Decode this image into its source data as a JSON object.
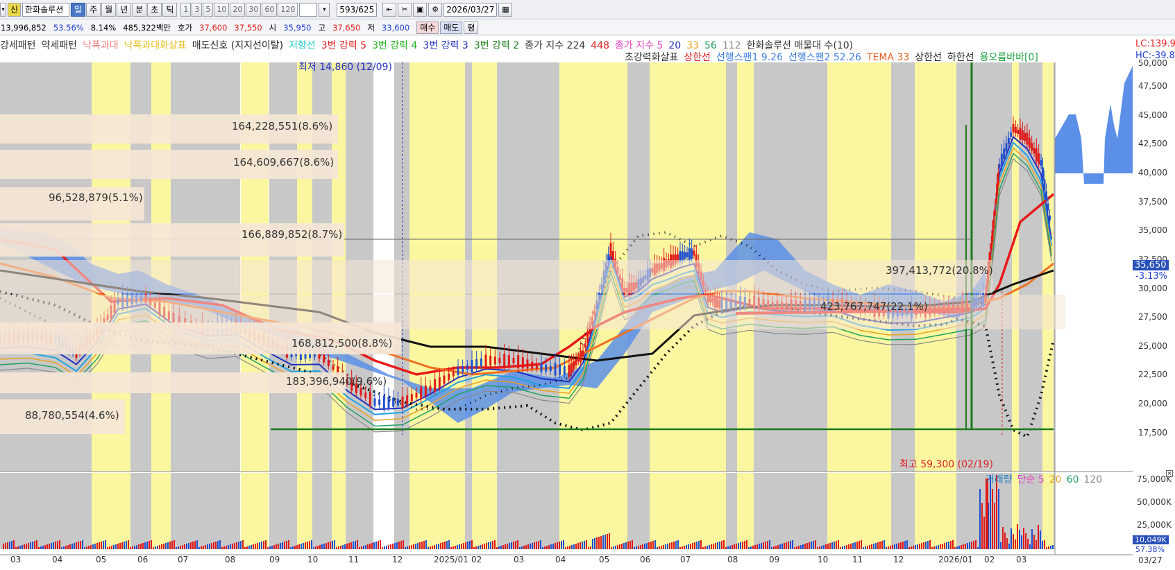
{
  "toolbar": {
    "stock_badge": "신",
    "stock_name": "한화솔루션",
    "periods": [
      "일",
      "주",
      "월",
      "년",
      "분",
      "초",
      "틱"
    ],
    "intervals": [
      "1",
      "3",
      "5",
      "10",
      "20",
      "30",
      "60",
      "120"
    ],
    "count": "593/625",
    "date": "2026/03/27"
  },
  "quote": {
    "volume": "13,996,852",
    "pct1": "53.56%",
    "pct2": "8.14%",
    "amount": "485,322백만",
    "hoga_label": "호가",
    "ask": "37,600",
    "bid": "37,550",
    "open_label": "시",
    "open": "35,950",
    "high_label": "고",
    "high": "37,650",
    "low_label": "저",
    "low": "33,600",
    "buy_btn": "매수",
    "sell_btn": "매도",
    "eval_btn": "평"
  },
  "legend": {
    "row1": [
      {
        "text": "강세패턴",
        "color": "#333333"
      },
      {
        "text": "약세패턴",
        "color": "#333333"
      },
      {
        "text": "낙폭과대",
        "color": "#f08080"
      },
      {
        "text": "낙폭과대화살표",
        "color": "#e8c020"
      },
      {
        "text": "매도신호 (지지선이탈)",
        "color": "#222222"
      },
      {
        "text": "저항선",
        "color": "#20c8c8"
      },
      {
        "text": "3번 강력 5",
        "color": "#e02020"
      },
      {
        "text": "3번 강력 4",
        "color": "#20b020"
      },
      {
        "text": "3번 강력 3",
        "color": "#2030c0"
      },
      {
        "text": "3번 강력 2",
        "color": "#208020"
      },
      {
        "text": "종가 지수 224",
        "color": "#333333"
      },
      {
        "text": "448",
        "color": "#e02020"
      },
      {
        "text": "종가 지수 5",
        "color": "#e040c0"
      },
      {
        "text": "20",
        "color": "#2030c0"
      },
      {
        "text": "33",
        "color": "#e8a020"
      },
      {
        "text": "56",
        "color": "#20a060"
      },
      {
        "text": "112",
        "color": "#888888"
      },
      {
        "text": "한화솔루션 매물대 수(10)",
        "color": "#333333"
      }
    ],
    "row2": [
      {
        "text": "초강력화살표",
        "color": "#333333"
      },
      {
        "text": "상한선",
        "color": "#e02020"
      },
      {
        "text": "선행스팬1 9.26",
        "color": "#4080e0"
      },
      {
        "text": "선행스팬2 52.26",
        "color": "#4080e0"
      },
      {
        "text": "TEMA 33",
        "color": "#e86020"
      },
      {
        "text": "상한선",
        "color": "#222222"
      },
      {
        "text": "하한선",
        "color": "#222222"
      },
      {
        "text": "용오름바바[0]",
        "color": "#20a040"
      }
    ],
    "lc": "LC:139.9",
    "hc": "HC:-39.8"
  },
  "volume_profile": [
    {
      "label": "164,228,551(8.6%)"
    },
    {
      "label": "164,609,667(8.6%)"
    },
    {
      "label": "96,528,879(5.1%)"
    },
    {
      "label": "166,889,852(8.7%)"
    },
    {
      "label": "397,413,772(20.8%)"
    },
    {
      "label": "423,767,747(22.1%)"
    },
    {
      "label": "183,396,940(9.6%)"
    },
    {
      "label": "88,780,554(4.6%)"
    },
    {
      "label": "168,812,500(8.8%)"
    }
  ],
  "annotations": {
    "low": "최저 14,860 (12/09)",
    "high": "최고 59,300 (02/19)"
  },
  "price_axis": [
    "50,000",
    "47,500",
    "45,000",
    "42,500",
    "40,000",
    "37,500",
    "35,000",
    "32,500",
    "30,000",
    "27,500",
    "25,000",
    "22,500",
    "20,000",
    "17,500"
  ],
  "current_price": "35,650",
  "current_change": "-3.13%",
  "volume_legend": [
    {
      "text": "거래량",
      "color": "#2080c0"
    },
    {
      "text": "단순 5",
      "color": "#e040c0"
    },
    {
      "text": "20",
      "color": "#e8a020"
    },
    {
      "text": "60",
      "color": "#20a060"
    },
    {
      "text": "120",
      "color": "#888888"
    }
  ],
  "volume_axis": [
    "75,000K",
    "50,000K",
    "25,000K"
  ],
  "current_volume": "10,049K",
  "volume_pct": "57.38%",
  "time_axis": [
    "03",
    "04",
    "05",
    "06",
    "07",
    "08",
    "09",
    "10",
    "11",
    "12",
    "2025/01",
    "02",
    "03",
    "04",
    "05",
    "06",
    "07",
    "08",
    "09",
    "10",
    "11",
    "12",
    "2026/01",
    "02",
    "03"
  ],
  "axis_date": "03/27",
  "colors": {
    "yellow_band": "#fbf7a0",
    "gray_band": "#c8c8c8",
    "cloud": "#5b8fe8",
    "bg": "#ffffff"
  }
}
